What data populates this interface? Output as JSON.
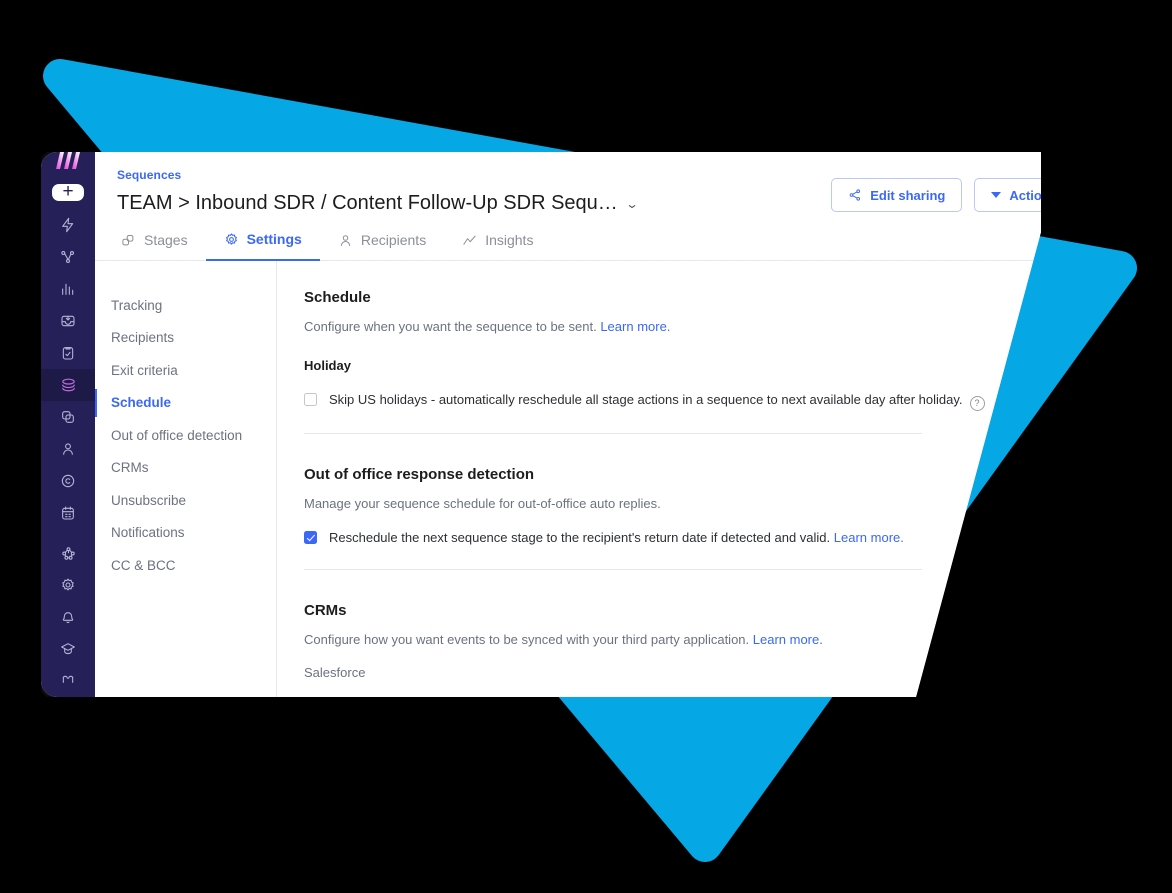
{
  "theme": {
    "background": "#000000",
    "decor_blue": "#06a7e5",
    "accent_blue": "#3b68f5",
    "rail_bg": "#252058",
    "rail_active_bg": "#1d1a47",
    "logo_pink": "#e640d8",
    "text_dark": "#1d1d1d",
    "text_muted": "#6b7280"
  },
  "rail": {
    "logo_name": "wingman-logo",
    "add_button_label": "+",
    "items": [
      {
        "name": "bolt-icon",
        "label": "Activity"
      },
      {
        "name": "workflow-icon",
        "label": "Workflows"
      },
      {
        "name": "bar-chart-icon",
        "label": "Analytics"
      },
      {
        "name": "inbox-icon",
        "label": "Inbox"
      },
      {
        "name": "task-clipboard-icon",
        "label": "Tasks"
      },
      {
        "name": "stack-layers-icon",
        "label": "Sequences",
        "active": true
      },
      {
        "name": "copy-deals-icon",
        "label": "Deals"
      },
      {
        "name": "person-icon",
        "label": "Contacts"
      },
      {
        "name": "copyright-circle-icon",
        "label": "Companies"
      },
      {
        "name": "calendar-icon",
        "label": "Calendar"
      }
    ],
    "bottom_items": [
      {
        "name": "integrations-icon",
        "label": "Integrations"
      },
      {
        "name": "gear-icon",
        "label": "Settings"
      },
      {
        "name": "bell-icon",
        "label": "Notifications"
      },
      {
        "name": "graduation-cap-icon",
        "label": "Learn"
      },
      {
        "name": "avatar-icon",
        "label": "Profile"
      }
    ]
  },
  "header": {
    "breadcrumb": "Sequences",
    "title": "TEAM > Inbound SDR / Content Follow-Up SDR Sequ…",
    "title_chevron": "chevron-down-icon",
    "edit_sharing_label": "Edit sharing",
    "edit_sharing_icon": "share-nodes-icon",
    "actions_label": "Actions",
    "actions_icon": "caret-down-icon"
  },
  "tabs": [
    {
      "label": "Stages",
      "icon": "stages-icon",
      "active": false
    },
    {
      "label": "Settings",
      "icon": "gear-icon",
      "active": true
    },
    {
      "label": "Recipients",
      "icon": "person-icon",
      "active": false
    },
    {
      "label": "Insights",
      "icon": "line-chart-icon",
      "active": false
    }
  ],
  "settings_nav": [
    {
      "label": "Tracking",
      "active": false
    },
    {
      "label": "Recipients",
      "active": false
    },
    {
      "label": "Exit criteria",
      "active": false
    },
    {
      "label": "Schedule",
      "active": true
    },
    {
      "label": "Out of office detection",
      "active": false
    },
    {
      "label": "CRMs",
      "active": false
    },
    {
      "label": "Unsubscribe",
      "active": false
    },
    {
      "label": "Notifications",
      "active": false
    },
    {
      "label": "CC & BCC",
      "active": false
    }
  ],
  "sections": {
    "schedule": {
      "title": "Schedule",
      "description": "Configure when you want the sequence to be sent.",
      "learn_more": "Learn more.",
      "holiday_label": "Holiday",
      "holiday_checkbox_label": "Skip US holidays - automatically reschedule all stage actions in a sequence to next available day after holiday.",
      "holiday_checked": false,
      "help_glyph": "?"
    },
    "ooo": {
      "title": "Out of office response detection",
      "description": "Manage your sequence schedule for out-of-office auto replies.",
      "checkbox_label": "Reschedule the next sequence stage to the recipient's return date if detected and valid.",
      "learn_more": "Learn more.",
      "checked": true
    },
    "crms": {
      "title": "CRMs",
      "description": "Configure how you want events to be synced with your third party application.",
      "learn_more": "Learn more.",
      "provider": "Salesforce"
    }
  }
}
